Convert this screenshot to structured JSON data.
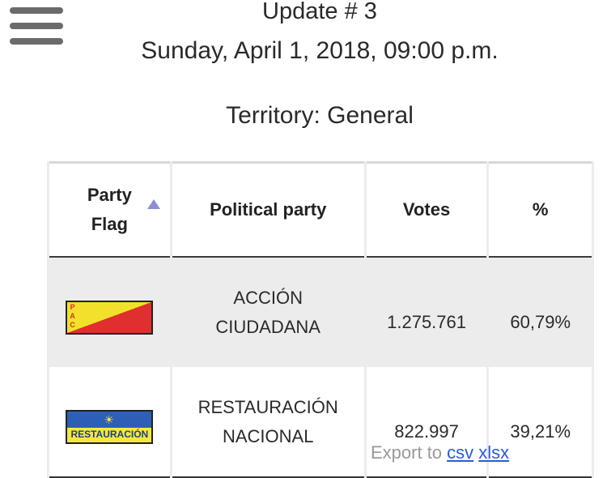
{
  "header": {
    "update": "Update # 3",
    "date": "Sunday, April 1, 2018, 09:00 p.m.",
    "territory": "Territory: General"
  },
  "table": {
    "columns": [
      "Party Flag",
      "Political party",
      "Votes",
      "%"
    ],
    "column_flag_line1": "Party",
    "column_flag_line2": "Flag",
    "rows": [
      {
        "party_line1": "ACCIÓN",
        "party_line2": "CIUDADANA",
        "votes": "1.275.761",
        "pct": "60,79%",
        "flag_text": "P A C"
      },
      {
        "party_line1": "RESTAURACIÓN",
        "party_line2": "NACIONAL",
        "votes": "822.997",
        "pct": "39,21%",
        "flag_text": "RESTAURACIÓN"
      }
    ]
  },
  "export": {
    "label": "Export to",
    "csv": "csv",
    "xlsx": "xlsx"
  },
  "colors": {
    "sort_arrow": "#8b8fd6",
    "link": "#2a5bd7",
    "stripe": "#ececec"
  }
}
